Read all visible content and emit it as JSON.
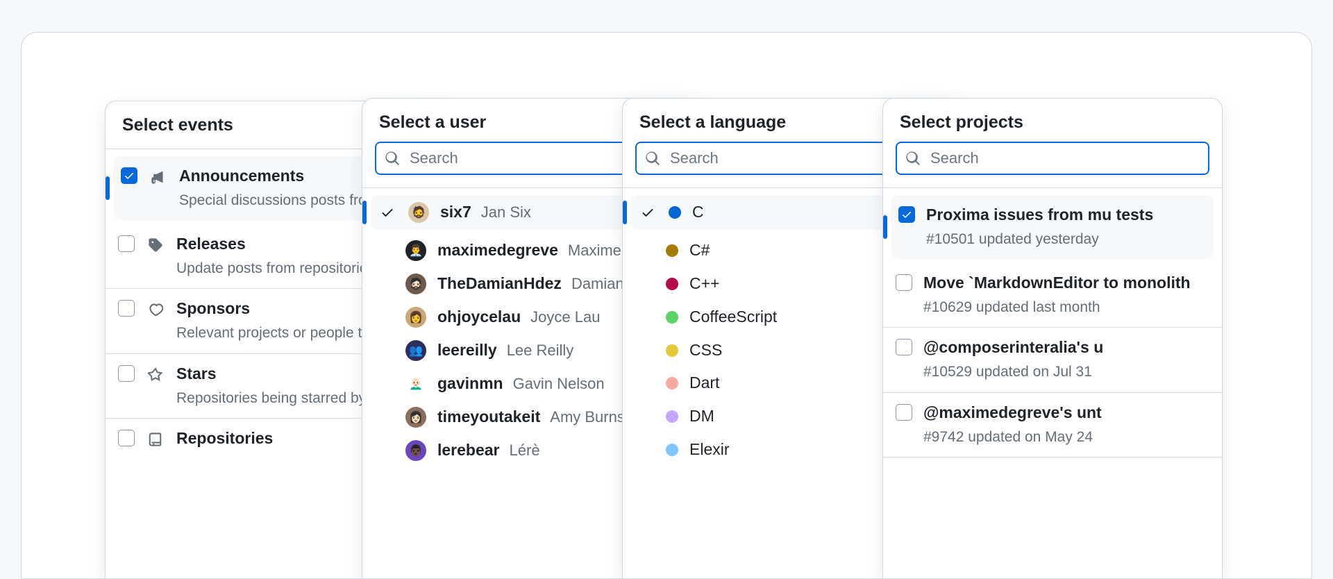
{
  "search_placeholder": "Search",
  "events": {
    "title": "Select events",
    "items": [
      {
        "title": "Announcements",
        "desc": "Special discussions posts from repositories",
        "checked": true,
        "icon": "megaphone"
      },
      {
        "title": "Releases",
        "desc": "Update posts from repositories",
        "checked": false,
        "icon": "tag"
      },
      {
        "title": "Sponsors",
        "desc": "Relevant projects or people that sponsored",
        "checked": false,
        "icon": "heart"
      },
      {
        "title": "Stars",
        "desc": "Repositories being starred by",
        "checked": false,
        "icon": "star"
      },
      {
        "title": "Repositories",
        "desc": "",
        "checked": false,
        "icon": "repo"
      }
    ]
  },
  "users": {
    "title": "Select a user",
    "items": [
      {
        "username": "six7",
        "fullname": "Jan Six",
        "selected": true,
        "avatar_bg": "#d9c7a9",
        "avatar_emoji": "🧔"
      },
      {
        "username": "maximedegreve",
        "fullname": "Maxime",
        "selected": false,
        "avatar_bg": "#1f2328",
        "avatar_emoji": "👨‍💼"
      },
      {
        "username": "TheDamianHdez",
        "fullname": "Damian",
        "selected": false,
        "avatar_bg": "#6e5a4a",
        "avatar_emoji": "🧔🏻"
      },
      {
        "username": "ohjoycelau",
        "fullname": "Joyce Lau",
        "selected": false,
        "avatar_bg": "#c9a875",
        "avatar_emoji": "👩"
      },
      {
        "username": "leereilly",
        "fullname": "Lee Reilly",
        "selected": false,
        "avatar_bg": "#2c2e5c",
        "avatar_emoji": "👥"
      },
      {
        "username": "gavinmn",
        "fullname": "Gavin Nelson",
        "selected": false,
        "avatar_bg": "#ffffff",
        "avatar_emoji": "👨🏻‍🦲"
      },
      {
        "username": "timeyoutakeit",
        "fullname": "Amy Burns",
        "selected": false,
        "avatar_bg": "#8b6f5c",
        "avatar_emoji": "👩🏻"
      },
      {
        "username": "lerebear",
        "fullname": "Lérè",
        "selected": false,
        "avatar_bg": "#6b46c1",
        "avatar_emoji": "👨🏿"
      }
    ]
  },
  "languages": {
    "title": "Select a language",
    "items": [
      {
        "name": "C",
        "color": "#0366d6",
        "selected": true
      },
      {
        "name": "C#",
        "color": "#a67c00",
        "selected": false
      },
      {
        "name": "C++",
        "color": "#b5094b",
        "selected": false
      },
      {
        "name": "CoffeeScript",
        "color": "#59d465",
        "selected": false
      },
      {
        "name": "CSS",
        "color": "#e3c935",
        "selected": false
      },
      {
        "name": "Dart",
        "color": "#f7a8a1",
        "selected": false
      },
      {
        "name": "DM",
        "color": "#c7a6ff",
        "selected": false
      },
      {
        "name": "Elexir",
        "color": "#7cc7ff",
        "selected": false
      }
    ]
  },
  "projects": {
    "title": "Select projects",
    "items": [
      {
        "title": "Proxima issues from mu tests",
        "desc": "#10501 updated yesterday",
        "checked": true
      },
      {
        "title": "Move `MarkdownEditor to monolith",
        "desc": "#10629 updated last month",
        "checked": false
      },
      {
        "title": "@composerinteralia's u",
        "desc": "#10529 updated on Jul 31",
        "checked": false
      },
      {
        "title": "@maximedegreve's unt",
        "desc": "#9742 updated on May 24",
        "checked": false
      }
    ]
  }
}
